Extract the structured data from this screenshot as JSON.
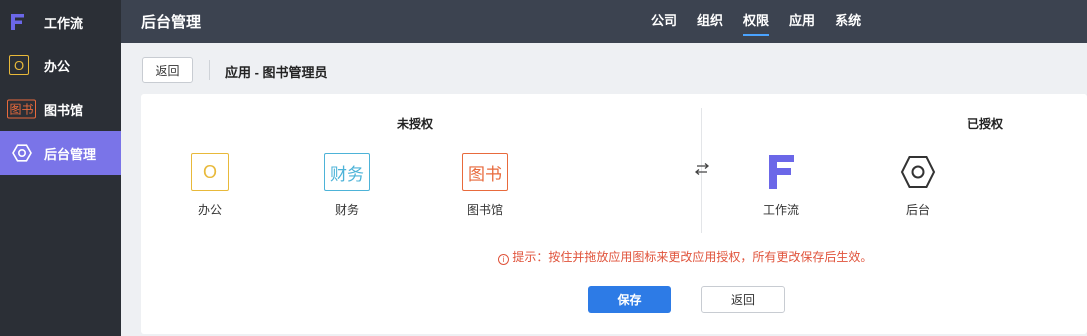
{
  "sidebar": {
    "items": [
      {
        "label": "工作流",
        "icon": "workflow-f-icon"
      },
      {
        "label": "办公",
        "icon": "office-icon",
        "icon_text": "O"
      },
      {
        "label": "图书馆",
        "icon": "library-icon",
        "icon_text": "图书"
      },
      {
        "label": "后台管理",
        "icon": "admin-hexagon-icon",
        "active": true
      }
    ]
  },
  "header": {
    "title": "后台管理",
    "tabs": [
      {
        "label": "公司"
      },
      {
        "label": "组织"
      },
      {
        "label": "权限",
        "active": true
      },
      {
        "label": "应用"
      },
      {
        "label": "系统"
      }
    ]
  },
  "toolbar": {
    "back_label": "返回",
    "breadcrumb": "应用 - 图书管理员"
  },
  "permissions": {
    "unauthorized_title": "未授权",
    "authorized_title": "已授权",
    "unauthorized_apps": [
      {
        "label": "办公",
        "icon_text": "O",
        "color": "#e8b93a"
      },
      {
        "label": "财务",
        "icon_text": "财务",
        "color": "#4db3d8"
      },
      {
        "label": "图书馆",
        "icon_text": "图书",
        "color": "#e86a3c"
      }
    ],
    "authorized_apps": [
      {
        "label": "工作流",
        "color": "#6b67e8"
      },
      {
        "label": "后台",
        "color": "#333333"
      }
    ],
    "hint": "提示：按住并拖放应用图标来更改应用授权，所有更改保存后生效。",
    "save_label": "保存",
    "back_label": "返回"
  },
  "colors": {
    "sidebar_bg": "#2b2f36",
    "topbar_bg": "#3c4350",
    "accent": "#7a74e8",
    "primary": "#2d7be6",
    "hint": "#e0533b"
  }
}
